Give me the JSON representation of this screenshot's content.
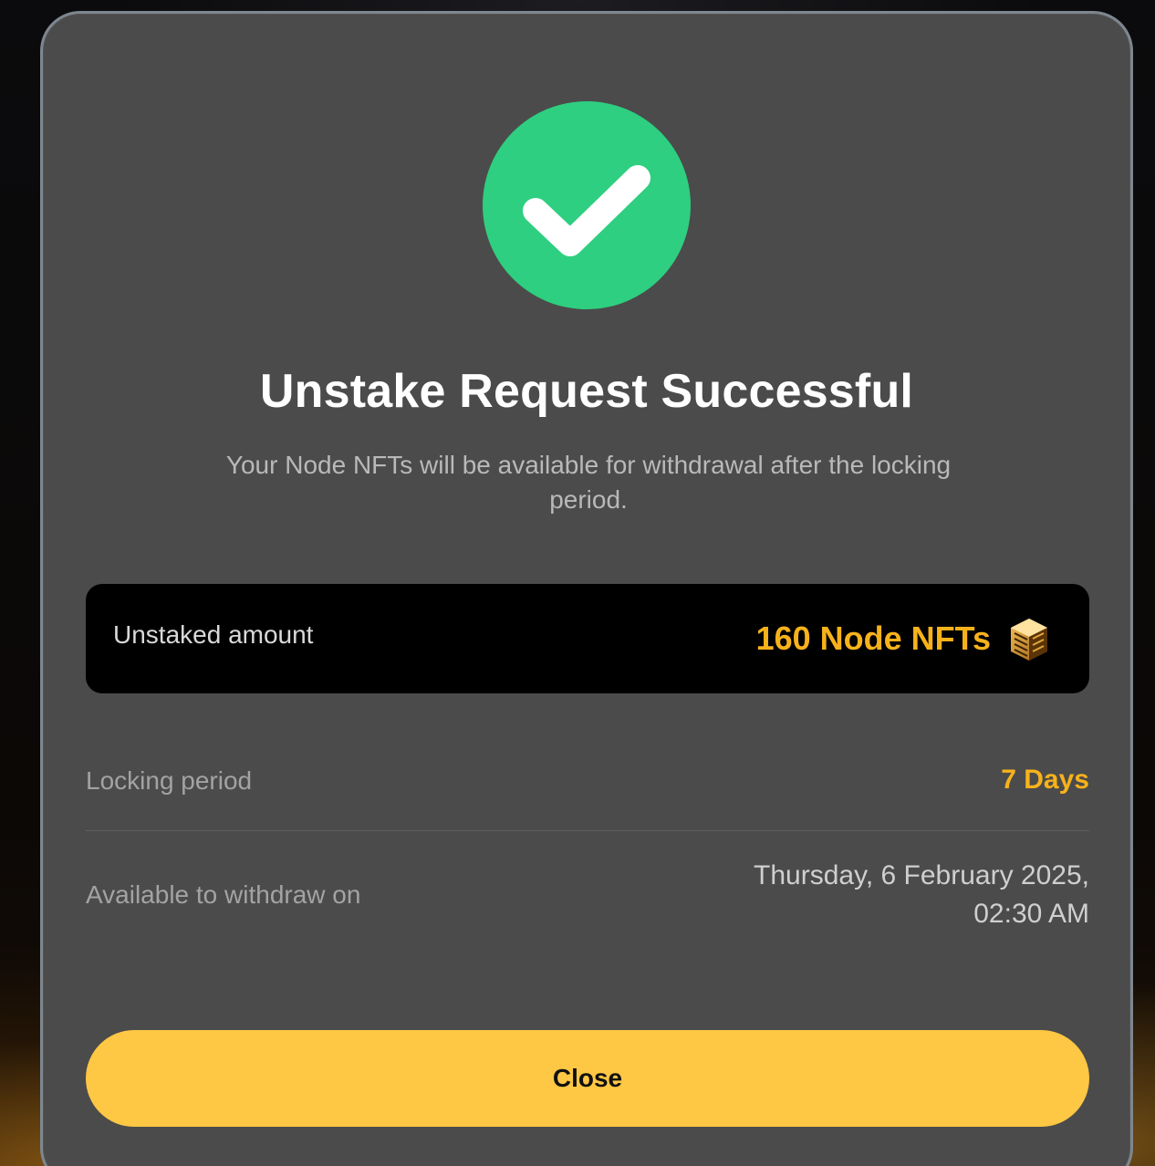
{
  "dialog": {
    "title": "Unstake Request Successful",
    "subtitle": "Your Node NFTs will be available for withdrawal after the locking period.",
    "icon": "checkmark-icon",
    "colors": {
      "success": "#2ecf80",
      "accent": "#f7b21b",
      "button": "#fec744",
      "panel": "#4b4b4b"
    }
  },
  "amount": {
    "label": "Unstaked amount",
    "value": "160 Node NFTs",
    "icon": "node-nft-icon"
  },
  "details": {
    "locking_label": "Locking period",
    "locking_value": "7 Days",
    "withdraw_label": "Available to withdraw on",
    "withdraw_date": "Thursday, 6 February 2025,",
    "withdraw_time": "02:30 AM"
  },
  "actions": {
    "close_label": "Close"
  }
}
